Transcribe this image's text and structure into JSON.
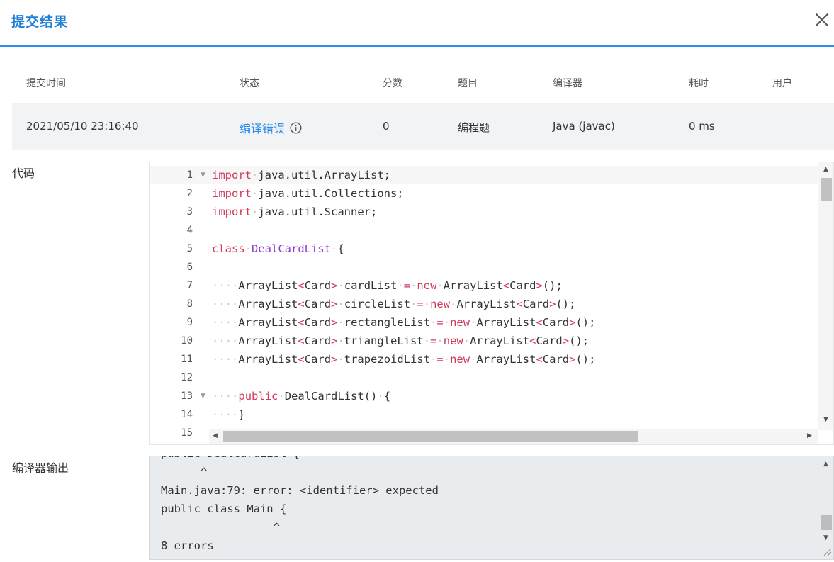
{
  "dialog": {
    "title": "提交结果",
    "close_icon": "close-icon"
  },
  "columns": [
    "提交时间",
    "状态",
    "分数",
    "题目",
    "编译器",
    "耗时",
    "用户"
  ],
  "submission": {
    "time": "2021/05/10 23:16:40",
    "status": "编译错误",
    "status_color": "#2d8cf0",
    "score": "0",
    "problem": "编程题",
    "compiler": "Java (javac)",
    "duration": "0 ms",
    "user": ""
  },
  "code_label": "代码",
  "output_label": "编译器输出",
  "code": {
    "line_numbers": [
      "1",
      "2",
      "3",
      "4",
      "5",
      "6",
      "7",
      "8",
      "9",
      "10",
      "11",
      "12",
      "13",
      "14",
      "15"
    ],
    "lines": [
      "import java.util.ArrayList;",
      "import java.util.Collections;",
      "import java.util.Scanner;",
      "",
      "class DealCardList {",
      "",
      "    ArrayList<Card> cardList = new ArrayList<Card>();",
      "    ArrayList<Card> circleList = new ArrayList<Card>();",
      "    ArrayList<Card> rectangleList = new ArrayList<Card>();",
      "    ArrayList<Card> triangleList = new ArrayList<Card>();",
      "    ArrayList<Card> trapezoidList = new ArrayList<Card>();",
      "",
      "    public DealCardList() {",
      "    }",
      ""
    ]
  },
  "compiler_output": {
    "lines": [
      "public DealCardList {",
      "      ^",
      "Main.java:79: error: <identifier> expected",
      "public class Main {",
      "                 ^",
      "8 errors"
    ]
  }
}
